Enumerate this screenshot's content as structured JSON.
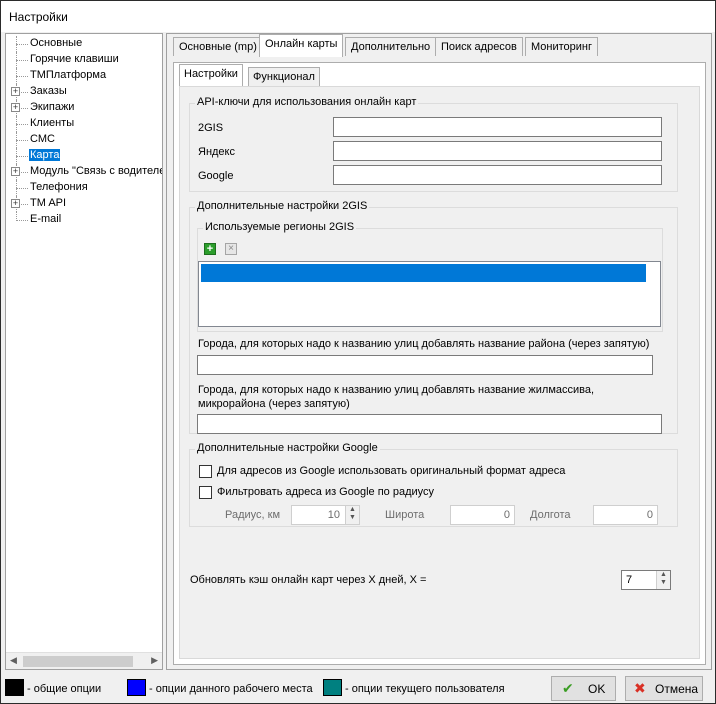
{
  "window": {
    "title": "Настройки"
  },
  "tree": {
    "items": [
      {
        "label": "Основные",
        "expandable": false,
        "selected": false
      },
      {
        "label": "Горячие клавиши",
        "expandable": false,
        "selected": false
      },
      {
        "label": "ТМПлатформа",
        "expandable": false,
        "selected": false
      },
      {
        "label": "Заказы",
        "expandable": true,
        "selected": false
      },
      {
        "label": "Экипажи",
        "expandable": true,
        "selected": false
      },
      {
        "label": "Клиенты",
        "expandable": false,
        "selected": false
      },
      {
        "label": "СМС",
        "expandable": false,
        "selected": false
      },
      {
        "label": "Карта",
        "expandable": false,
        "selected": true
      },
      {
        "label": "Модуль \"Связь с водителем\"",
        "expandable": true,
        "selected": false
      },
      {
        "label": "Телефония",
        "expandable": false,
        "selected": false
      },
      {
        "label": "TM API",
        "expandable": true,
        "selected": false
      },
      {
        "label": "E-mail",
        "expandable": false,
        "selected": false
      }
    ]
  },
  "tabs": [
    "Основные (mp)",
    "Онлайн карты",
    "Дополнительно",
    "Поиск адресов",
    "Мониторинг"
  ],
  "subtabs": [
    "Настройки",
    "Функционал"
  ],
  "api_keys": {
    "title": "API-ключи для использования онлайн карт",
    "fields": [
      {
        "label": "2GIS",
        "value": ""
      },
      {
        "label": "Яндекс",
        "value": ""
      },
      {
        "label": "Google",
        "value": ""
      }
    ]
  },
  "gis": {
    "title": "Дополнительные настройки 2GIS",
    "regions_title": "Используемые регионы 2GIS",
    "district_label": "Города, для которых надо к названию улиц добавлять название района (через запятую)",
    "district_value": "",
    "microdistrict_label_1": "Города, для которых надо к названию улиц добавлять название жилмассива,",
    "microdistrict_label_2": "микрорайона (через запятую)",
    "microdistrict_value": ""
  },
  "google": {
    "title": "Дополнительные настройки Google",
    "original_format_label": "Для адресов из Google использовать оригинальный формат адреса",
    "original_format_checked": false,
    "radius_filter_label": "Фильтровать адреса из Google по радиусу",
    "radius_filter_checked": false,
    "radius_label": "Радиус, км",
    "radius_value": "10",
    "lat_label": "Широта",
    "lat_value": "0",
    "lon_label": "Долгота",
    "lon_value": "0"
  },
  "cache": {
    "label": "Обновлять кэш онлайн карт через X дней, X =",
    "value": "7"
  },
  "legend": [
    {
      "label": "- общие опции",
      "color": "#000000"
    },
    {
      "label": "- опции данного рабочего места",
      "color": "#0000ff"
    },
    {
      "label": "- опции текущего пользователя",
      "color": "#008080"
    }
  ],
  "buttons": {
    "ok": "OK",
    "cancel": "Отмена"
  }
}
